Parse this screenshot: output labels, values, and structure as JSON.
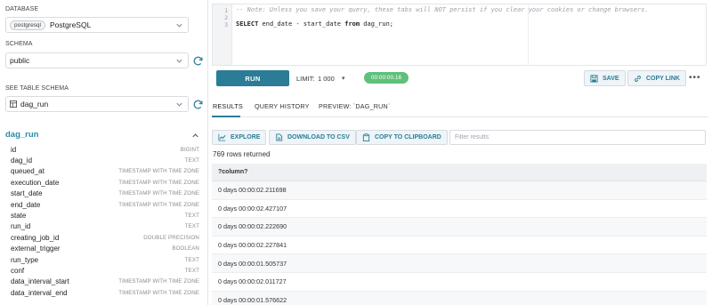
{
  "sidebar": {
    "database_label": "DATABASE",
    "database_badge": "postgresql",
    "database_value": "PostgreSQL",
    "schema_label": "SCHEMA",
    "schema_value": "public",
    "table_schema_label": "SEE TABLE SCHEMA",
    "table_value": "dag_run",
    "schema_table_title": "dag_run",
    "columns": [
      {
        "name": "id",
        "type": "BIGINT"
      },
      {
        "name": "dag_id",
        "type": "TEXT"
      },
      {
        "name": "queued_at",
        "type": "TIMESTAMP WITH TIME ZONE"
      },
      {
        "name": "execution_date",
        "type": "TIMESTAMP WITH TIME ZONE"
      },
      {
        "name": "start_date",
        "type": "TIMESTAMP WITH TIME ZONE"
      },
      {
        "name": "end_date",
        "type": "TIMESTAMP WITH TIME ZONE"
      },
      {
        "name": "state",
        "type": "TEXT"
      },
      {
        "name": "run_id",
        "type": "TEXT"
      },
      {
        "name": "creating_job_id",
        "type": "DOUBLE PRECISION"
      },
      {
        "name": "external_trigger",
        "type": "BOOLEAN"
      },
      {
        "name": "run_type",
        "type": "TEXT"
      },
      {
        "name": "conf",
        "type": "TEXT"
      },
      {
        "name": "data_interval_start",
        "type": "TIMESTAMP WITH TIME ZONE"
      },
      {
        "name": "data_interval_end",
        "type": "TIMESTAMP WITH TIME ZONE"
      }
    ]
  },
  "editor": {
    "line_numbers": [
      "1",
      "2",
      "3"
    ],
    "comment": "-- Note: Unless you save your query, these tabs will NOT persist if you clear your cookies or change browsers.",
    "sql_kw1": "SELECT",
    "sql_mid": " end_date - start_date ",
    "sql_kw2": "from",
    "sql_end": " dag_run;"
  },
  "toolbar": {
    "run_label": "RUN",
    "limit_label": "LIMIT:",
    "limit_value": "1 000",
    "limit_chevron": "▾",
    "timer": "00:00:00.16",
    "save_label": "SAVE",
    "copy_link_label": "COPY LINK",
    "more": "•••"
  },
  "result_tabs": {
    "results": "RESULTS",
    "history": "QUERY HISTORY",
    "preview": "PREVIEW: `DAG_RUN`"
  },
  "result_actions": {
    "explore": "EXPLORE",
    "download": "DOWNLOAD TO CSV",
    "clipboard": "COPY TO CLIPBOARD",
    "filter_placeholder": "Filter results"
  },
  "results": {
    "rows_returned": "769 rows returned",
    "column": "?column?",
    "rows": [
      "0 days 00:00:02.211698",
      "0 days 00:00:02.427107",
      "0 days 00:00:02.222690",
      "0 days 00:00:02.227841",
      "0 days 00:00:01.505737",
      "0 days 00:00:02.011727",
      "0 days 00:00:01.576622"
    ]
  },
  "colors": {
    "accent": "#2b7c96",
    "schema_title": "#2a8aa6",
    "timer_bg": "#5fc07a"
  }
}
